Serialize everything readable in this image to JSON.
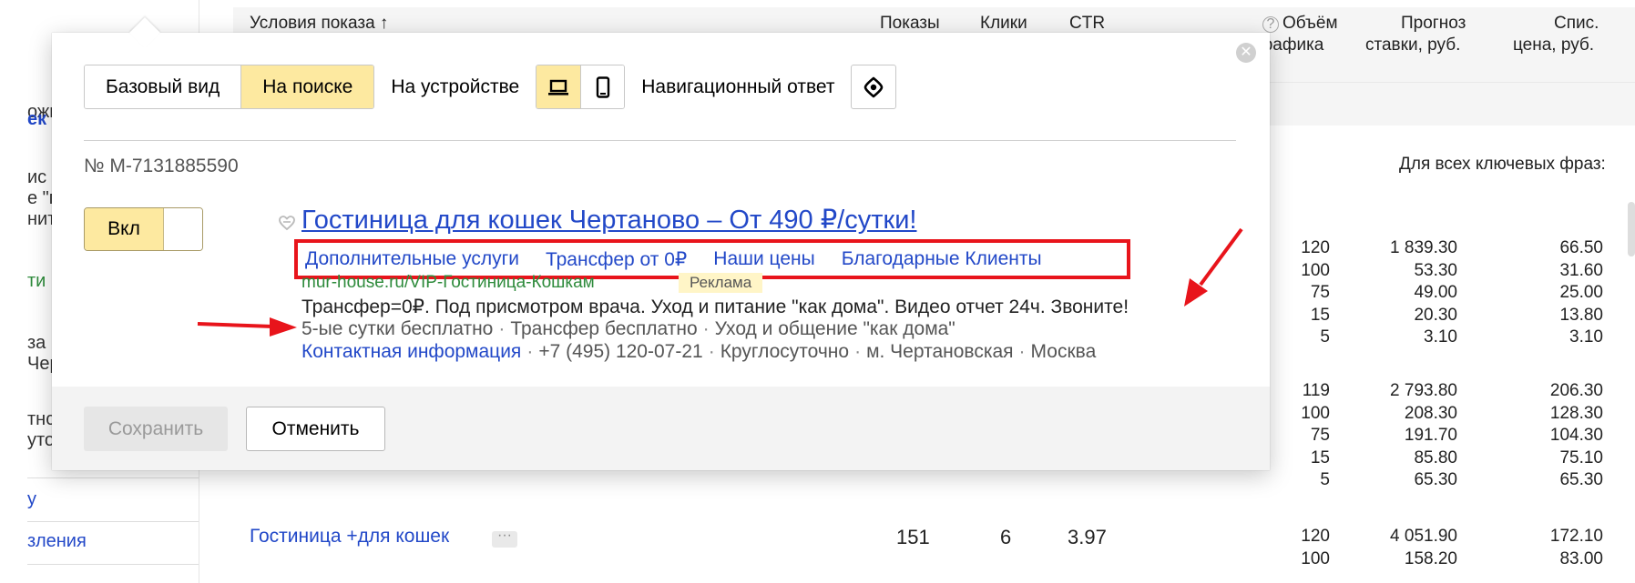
{
  "sidebar": {
    "fragments": [
      "ожи",
      "ек",
      "ис",
      "е \"г",
      "нит",
      "ти",
      "за (",
      "Чер",
      "тнс",
      "уто",
      "у",
      "зления"
    ]
  },
  "table": {
    "headers": {
      "conditions": "Условия показа ↑",
      "shows": "Показы",
      "clicks": "Клики",
      "ctr": "CTR",
      "traffic_line1": "Объём",
      "traffic_line2": "трафика",
      "forecast_line1": "Прогноз",
      "forecast_line2": "ставки, руб.",
      "charge_line1": "Спис.",
      "charge_line2": "цена, руб."
    },
    "all_phrases_label": "Для всех ключевых фраз:",
    "group1": {
      "traffic": [
        "120",
        "100",
        "75",
        "15",
        "5"
      ],
      "forecast": [
        "1 839.30",
        "53.30",
        "49.00",
        "20.30",
        "3.10"
      ],
      "charge": [
        "66.50",
        "31.60",
        "25.00",
        "13.80",
        "3.10"
      ]
    },
    "group2": {
      "traffic": [
        "119",
        "100",
        "75",
        "15",
        "5"
      ],
      "forecast": [
        "2 793.80",
        "208.30",
        "191.70",
        "85.80",
        "65.30"
      ],
      "charge": [
        "206.30",
        "128.30",
        "104.30",
        "75.10",
        "65.30"
      ]
    },
    "bottom_row": {
      "keyword": "Гостиница +для кошек",
      "dots": "···",
      "shows": "151",
      "clicks": "6",
      "ctr": "3.97",
      "traffic": [
        "120",
        "100"
      ],
      "forecast": [
        "4 051.90",
        "158.20"
      ],
      "charge": [
        "172.10",
        "83.00"
      ]
    }
  },
  "popup": {
    "close_glyph": "✕",
    "view_tabs": [
      "Базовый вид",
      "На поиске"
    ],
    "device_label": "На устройстве",
    "nav_answer_label": "Навигационный ответ",
    "ad_number": "№ M-7131885590",
    "toggle_label": "Вкл",
    "ad": {
      "title": "Гостиница для кошек Чертаново – От 490 ₽/сутки!",
      "sitelinks": [
        "Дополнительные услуги",
        "Трансфер от 0₽",
        "Наши цены",
        "Благодарные Клиенты"
      ],
      "url": "mur-house.ru/VIP-Гостиница-Кошкам",
      "badge": "Реклама",
      "text": "Трансфер=0₽. Под присмотром врача. Уход и питание \"как дома\". Видео отчет 24ч. Звоните!",
      "callouts": [
        "5-ые сутки бесплатно",
        "Трансфер бесплатно",
        "Уход и общение \"как дома\""
      ],
      "contact_link": "Контактная информация",
      "contacts": [
        "+7 (495) 120-07-21",
        "Круглосуточно",
        "м. Чертановская",
        "Москва"
      ],
      "separator": "·"
    },
    "save_label": "Сохранить",
    "cancel_label": "Отменить"
  },
  "colors": {
    "accent_yellow": "#fde9a0",
    "link_blue": "#2248c8",
    "url_green": "#2e8b3c",
    "highlight_red": "#e8141b"
  }
}
